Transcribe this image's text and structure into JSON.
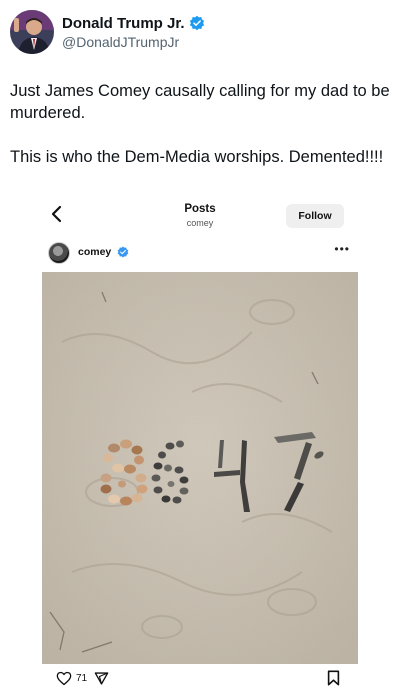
{
  "tweet": {
    "display_name": "Donald Trump Jr.",
    "handle": "@DonaldJTrumpJr",
    "paragraphs": [
      "Just James Comey causally calling for my dad to be murdered.",
      "This is who the Dem-Media worships. Demented!!!!"
    ],
    "verified_color": "#1d9bf0"
  },
  "embed": {
    "nav_title": "Posts",
    "nav_subtitle": "comey",
    "follow_label": "Follow",
    "username": "comey",
    "more_icon": "•••",
    "photo_caption_in_sand": "8647",
    "like_count": "71",
    "icons": [
      "back-arrow-icon",
      "verified-badge-icon",
      "more-options-icon",
      "heart-icon",
      "send-icon",
      "bookmark-icon"
    ]
  },
  "colors": {
    "sand": "#cbc3b6",
    "text": "#0f1419",
    "muted": "#536471"
  }
}
